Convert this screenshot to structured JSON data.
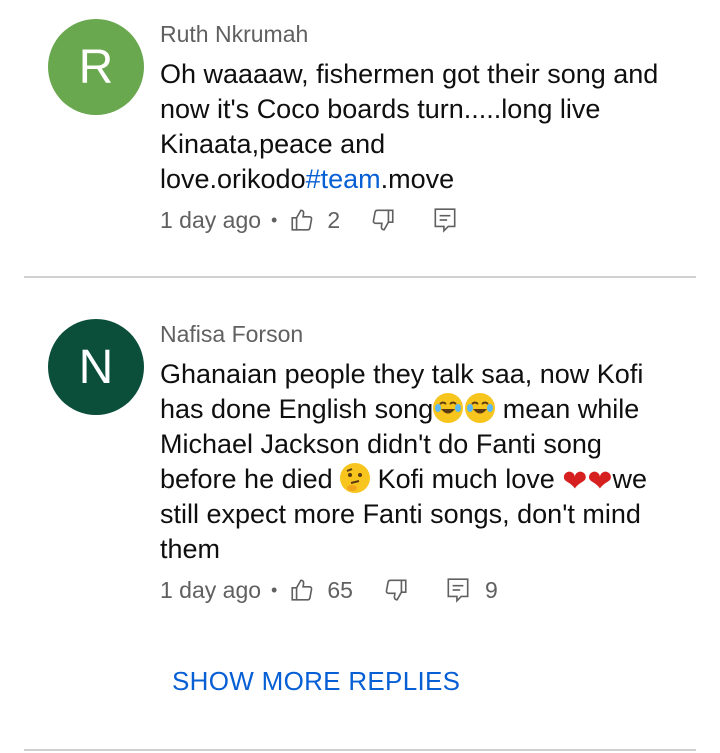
{
  "comments": [
    {
      "avatar_letter": "R",
      "avatar_color": "#6aa84f",
      "author": "Ruth Nkrumah",
      "text_part1": "Oh waaaaw, fishermen got their song and now it's Coco boards turn.....long live Kinaata,peace and love.orikodo",
      "hashtag": "#team",
      "text_part2": ".move",
      "time": "1 day ago",
      "likes": "2",
      "replies": ""
    },
    {
      "avatar_letter": "N",
      "avatar_color": "#0b4f3b",
      "author": "Nafisa Forson",
      "text_a": "Ghanaian people they talk saa, now Kofi has done English song",
      "text_b": " mean while Michael Jackson didn't do Fanti song before he died ",
      "text_c": " Kofi much love ",
      "text_d": "we still expect more Fanti songs, don't mind them",
      "time": "1 day ago",
      "likes": "65",
      "replies": "9"
    }
  ],
  "icons": {
    "like": "thumbs-up-icon",
    "dislike": "thumbs-down-icon",
    "reply": "reply-comment-icon",
    "emoji1": "face-with-tears-of-joy-emoji",
    "emoji2": "thinking-face-emoji",
    "emoji3": "red-heart-emoji"
  },
  "show_more": "SHOW MORE REPLIES",
  "colors": {
    "link": "#065fd4",
    "meta": "#606060",
    "divider": "#d0d0d0"
  }
}
